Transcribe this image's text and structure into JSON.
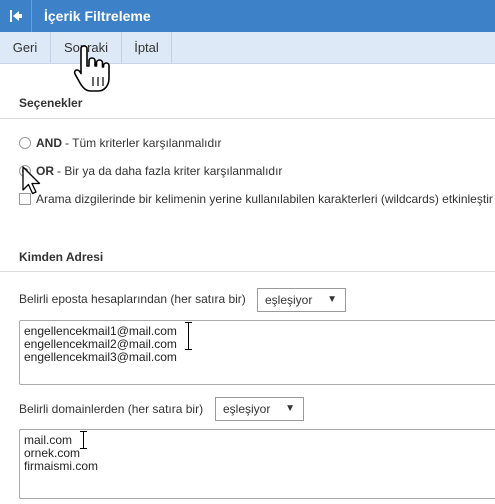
{
  "window": {
    "title": "İçerik Filtreleme"
  },
  "toolbar": {
    "back_label": "Geri",
    "next_label": "Sonraki",
    "cancel_label": "İptal"
  },
  "options_section": {
    "title": "Seçenekler",
    "and_option": {
      "keyword": "AND",
      "text": "- Tüm kriterler karşılanmalıdır",
      "selected": false
    },
    "or_option": {
      "keyword": "OR",
      "text": "- Bir ya da daha fazla kriter karşılanmalıdır",
      "selected": true
    },
    "wildcards_option": {
      "text": "Arama dizgilerinde bir kelimenin yerine kullanılabilen karakterleri (wildcards) etkinleştir",
      "checked": false
    }
  },
  "from_section": {
    "title": "Kimden Adresi",
    "accounts_label": "Belirli eposta hesaplarından (her satıra bir)",
    "accounts_match": "eşleşiyor",
    "accounts": [
      "engellencekmail1@mail.com",
      "engellencekmail2@mail.com",
      "engellencekmail3@mail.com"
    ],
    "domains_label": "Belirli domainlerden (her satıra bir)",
    "domains_match": "eşleşiyor",
    "domains": [
      "mail.com",
      "ornek.com",
      "firmaismi.com"
    ]
  },
  "icons": {
    "back": "arrow-bar-left-icon",
    "dropdown": "triangle-down-icon",
    "hand_cursor": "hand-pointer-icon",
    "arrow_cursor": "arrow-pointer-icon",
    "text_cursor": "ibeam-cursor-icon"
  },
  "colors": {
    "titlebar": "#3d82c9",
    "toolbar": "#dde9f6"
  }
}
